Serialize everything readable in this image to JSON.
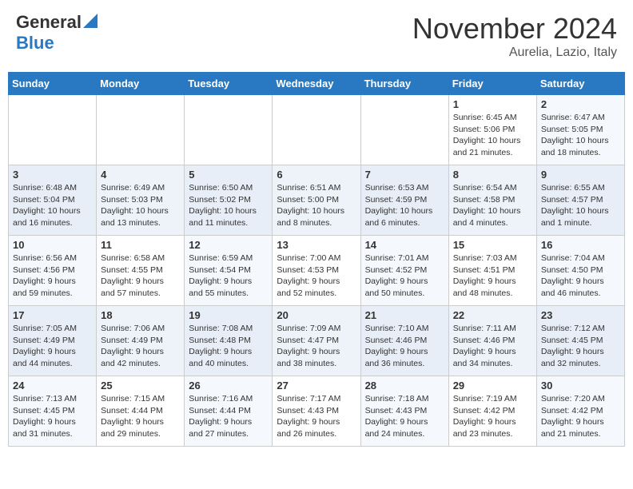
{
  "header": {
    "logo_general": "General",
    "logo_blue": "Blue",
    "month_title": "November 2024",
    "location": "Aurelia, Lazio, Italy"
  },
  "weekdays": [
    "Sunday",
    "Monday",
    "Tuesday",
    "Wednesday",
    "Thursday",
    "Friday",
    "Saturday"
  ],
  "weeks": [
    [
      {
        "day": "",
        "info": ""
      },
      {
        "day": "",
        "info": ""
      },
      {
        "day": "",
        "info": ""
      },
      {
        "day": "",
        "info": ""
      },
      {
        "day": "",
        "info": ""
      },
      {
        "day": "1",
        "info": "Sunrise: 6:45 AM\nSunset: 5:06 PM\nDaylight: 10 hours\nand 21 minutes."
      },
      {
        "day": "2",
        "info": "Sunrise: 6:47 AM\nSunset: 5:05 PM\nDaylight: 10 hours\nand 18 minutes."
      }
    ],
    [
      {
        "day": "3",
        "info": "Sunrise: 6:48 AM\nSunset: 5:04 PM\nDaylight: 10 hours\nand 16 minutes."
      },
      {
        "day": "4",
        "info": "Sunrise: 6:49 AM\nSunset: 5:03 PM\nDaylight: 10 hours\nand 13 minutes."
      },
      {
        "day": "5",
        "info": "Sunrise: 6:50 AM\nSunset: 5:02 PM\nDaylight: 10 hours\nand 11 minutes."
      },
      {
        "day": "6",
        "info": "Sunrise: 6:51 AM\nSunset: 5:00 PM\nDaylight: 10 hours\nand 8 minutes."
      },
      {
        "day": "7",
        "info": "Sunrise: 6:53 AM\nSunset: 4:59 PM\nDaylight: 10 hours\nand 6 minutes."
      },
      {
        "day": "8",
        "info": "Sunrise: 6:54 AM\nSunset: 4:58 PM\nDaylight: 10 hours\nand 4 minutes."
      },
      {
        "day": "9",
        "info": "Sunrise: 6:55 AM\nSunset: 4:57 PM\nDaylight: 10 hours\nand 1 minute."
      }
    ],
    [
      {
        "day": "10",
        "info": "Sunrise: 6:56 AM\nSunset: 4:56 PM\nDaylight: 9 hours\nand 59 minutes."
      },
      {
        "day": "11",
        "info": "Sunrise: 6:58 AM\nSunset: 4:55 PM\nDaylight: 9 hours\nand 57 minutes."
      },
      {
        "day": "12",
        "info": "Sunrise: 6:59 AM\nSunset: 4:54 PM\nDaylight: 9 hours\nand 55 minutes."
      },
      {
        "day": "13",
        "info": "Sunrise: 7:00 AM\nSunset: 4:53 PM\nDaylight: 9 hours\nand 52 minutes."
      },
      {
        "day": "14",
        "info": "Sunrise: 7:01 AM\nSunset: 4:52 PM\nDaylight: 9 hours\nand 50 minutes."
      },
      {
        "day": "15",
        "info": "Sunrise: 7:03 AM\nSunset: 4:51 PM\nDaylight: 9 hours\nand 48 minutes."
      },
      {
        "day": "16",
        "info": "Sunrise: 7:04 AM\nSunset: 4:50 PM\nDaylight: 9 hours\nand 46 minutes."
      }
    ],
    [
      {
        "day": "17",
        "info": "Sunrise: 7:05 AM\nSunset: 4:49 PM\nDaylight: 9 hours\nand 44 minutes."
      },
      {
        "day": "18",
        "info": "Sunrise: 7:06 AM\nSunset: 4:49 PM\nDaylight: 9 hours\nand 42 minutes."
      },
      {
        "day": "19",
        "info": "Sunrise: 7:08 AM\nSunset: 4:48 PM\nDaylight: 9 hours\nand 40 minutes."
      },
      {
        "day": "20",
        "info": "Sunrise: 7:09 AM\nSunset: 4:47 PM\nDaylight: 9 hours\nand 38 minutes."
      },
      {
        "day": "21",
        "info": "Sunrise: 7:10 AM\nSunset: 4:46 PM\nDaylight: 9 hours\nand 36 minutes."
      },
      {
        "day": "22",
        "info": "Sunrise: 7:11 AM\nSunset: 4:46 PM\nDaylight: 9 hours\nand 34 minutes."
      },
      {
        "day": "23",
        "info": "Sunrise: 7:12 AM\nSunset: 4:45 PM\nDaylight: 9 hours\nand 32 minutes."
      }
    ],
    [
      {
        "day": "24",
        "info": "Sunrise: 7:13 AM\nSunset: 4:45 PM\nDaylight: 9 hours\nand 31 minutes."
      },
      {
        "day": "25",
        "info": "Sunrise: 7:15 AM\nSunset: 4:44 PM\nDaylight: 9 hours\nand 29 minutes."
      },
      {
        "day": "26",
        "info": "Sunrise: 7:16 AM\nSunset: 4:44 PM\nDaylight: 9 hours\nand 27 minutes."
      },
      {
        "day": "27",
        "info": "Sunrise: 7:17 AM\nSunset: 4:43 PM\nDaylight: 9 hours\nand 26 minutes."
      },
      {
        "day": "28",
        "info": "Sunrise: 7:18 AM\nSunset: 4:43 PM\nDaylight: 9 hours\nand 24 minutes."
      },
      {
        "day": "29",
        "info": "Sunrise: 7:19 AM\nSunset: 4:42 PM\nDaylight: 9 hours\nand 23 minutes."
      },
      {
        "day": "30",
        "info": "Sunrise: 7:20 AM\nSunset: 4:42 PM\nDaylight: 9 hours\nand 21 minutes."
      }
    ]
  ]
}
